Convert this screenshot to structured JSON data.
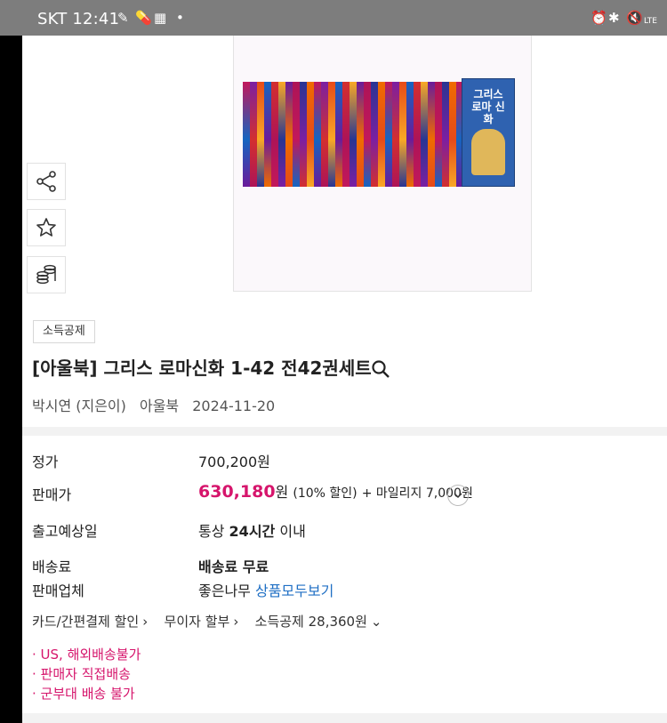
{
  "status_bar": {
    "carrier_time": "SKT 12:41",
    "network": "LTE"
  },
  "side_actions": [
    {
      "icon": "share-icon"
    },
    {
      "icon": "star-icon"
    },
    {
      "icon": "coins-icon"
    }
  ],
  "product": {
    "badge": "소득공제",
    "title": "[아울북] 그리스 로마신화 1-42 전42권세트",
    "author": "박시연 (지은이)",
    "publisher": "아울북",
    "date": "2024-11-20",
    "cover_text": "그리스 로마 신화"
  },
  "info": {
    "list_price_label": "정가",
    "list_price": "700,200원",
    "sale_price_label": "판매가",
    "sale_price": "630,180",
    "sale_unit": "원",
    "discount": "(10% 할인)",
    "mileage": "+ 마일리지 7,000원",
    "shipping_date_label": "출고예상일",
    "shipping_prefix": "통상",
    "shipping_bold": "24시간",
    "shipping_suffix": "이내",
    "delivery_fee_label": "배송료",
    "delivery_fee": "배송료 무료",
    "seller_label": "판매업체",
    "seller": "좋은나무",
    "seller_link": "상품모두보기"
  },
  "benefits": {
    "card": "카드/간편결제 할인",
    "installment": "무이자 할부",
    "deduction": "소득공제 28,360원"
  },
  "notes": [
    "US, 해외배송불가",
    "판매자 직접배송",
    "군부대 배송 불가"
  ],
  "colors": {
    "accent": "#d6156c",
    "link": "#1f6fc4",
    "status_bar": "#7d7d7d"
  }
}
